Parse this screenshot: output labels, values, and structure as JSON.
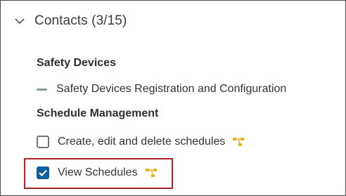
{
  "section": {
    "title": "Contacts (3/15)",
    "expand_icon": "chevron-down-icon"
  },
  "groups": [
    {
      "title": "Safety Devices",
      "items": [
        {
          "label": "Safety Devices Registration and Configuration",
          "state": "indeterminate"
        }
      ]
    },
    {
      "title": "Schedule Management",
      "items": [
        {
          "label": "Create, edit and delete schedules",
          "state": "unchecked",
          "icon": "hierarchy-icon"
        },
        {
          "label": "View Schedules",
          "state": "checked",
          "icon": "hierarchy-icon",
          "highlighted": true
        }
      ]
    }
  ],
  "colors": {
    "checkbox_checked": "#0f5f9d",
    "hierarchy_icon": "#f0b11c",
    "highlight_border": "#a8262b"
  }
}
